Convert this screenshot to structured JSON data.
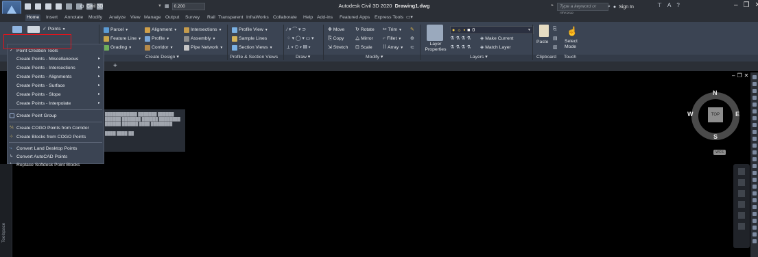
{
  "titlebar": {
    "workspace": "Civil 3D",
    "lineweight_value": "0.200",
    "app_title": "Autodesk Civil 3D 2020",
    "document": "Drawing1.dwg",
    "search_placeholder": "Type a keyword or phrase",
    "sign_in": "Sign In",
    "logo_text": "C3D"
  },
  "tabs": [
    "Home",
    "Insert",
    "Annotate",
    "Modify",
    "Analyze",
    "View",
    "Manage",
    "Output",
    "Survey",
    "Rail",
    "Transparent",
    "InfraWorks",
    "Collaborate",
    "Help",
    "Add-ins",
    "Featured Apps",
    "Express Tools"
  ],
  "active_tab": "Home",
  "ribbon": {
    "points": "Points",
    "parcel": "Parcel",
    "feature_line": "Feature Line",
    "grading": "Grading",
    "alignment": "Alignment",
    "profile": "Profile",
    "corridor": "Corridor",
    "intersections": "Intersections",
    "assembly": "Assembly",
    "pipe_network": "Pipe Network",
    "profile_view": "Profile View",
    "sample_lines": "Sample Lines",
    "section_views": "Section Views",
    "move": "Move",
    "copy": "Copy",
    "stretch": "Stretch",
    "rotate": "Rotate",
    "mirror": "Mirror",
    "scale": "Scale",
    "trim": "Trim",
    "fillet": "Fillet",
    "array": "Array",
    "layer_properties": "Layer Properties",
    "layer_number": "0",
    "make_current": "Make Current",
    "match_layer": "Match Layer",
    "paste": "Paste",
    "select_mode": "Select Mode"
  },
  "panels": {
    "create_design": "Create Design",
    "profile_section": "Profile & Section Views",
    "draw": "Draw",
    "modify": "Modify",
    "layers": "Layers",
    "clipboard": "Clipboard",
    "touch": "Touch"
  },
  "menu": {
    "items": [
      "Point Creation Tools",
      "Create Points - Miscellaneous",
      "Create Points - Intersections",
      "Create Points - Alignments",
      "Create Points - Surface",
      "Create Points - Slope",
      "Create Points - Interpolate",
      "Create Point Group",
      "Create COGO Points from Corridor",
      "Create Blocks from COGO Points",
      "Convert Land Desktop Points",
      "Convert AutoCAD Points",
      "Replace Softdesk Point Blocks"
    ]
  },
  "viewcube": {
    "north": "N",
    "south": "S",
    "east": "E",
    "west": "W",
    "top": "TOP",
    "wcs": "WCS"
  },
  "toolspace": "Toolspace"
}
